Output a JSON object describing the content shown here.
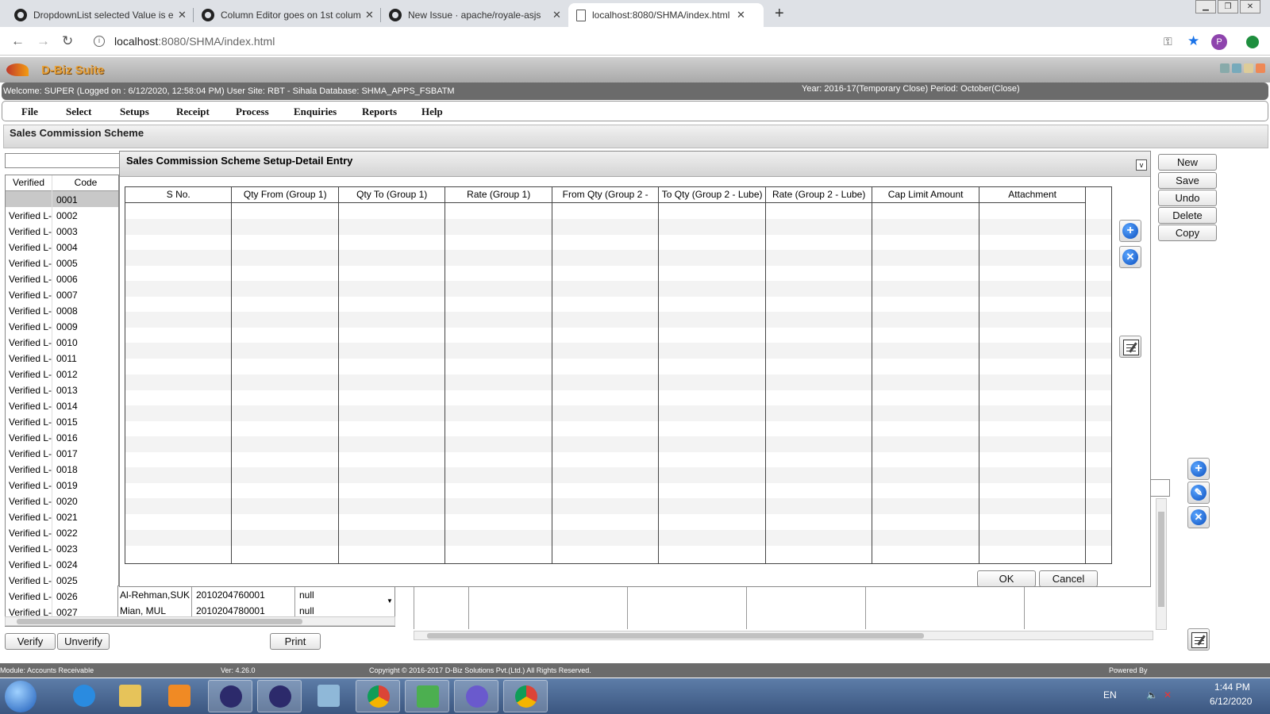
{
  "browser": {
    "tabs": [
      {
        "title": "DropdownList selected Value is e",
        "icon": "github-icon"
      },
      {
        "title": "Column Editor goes on 1st colum",
        "icon": "github-icon"
      },
      {
        "title": "New Issue · apache/royale-asjs",
        "icon": "github-icon"
      },
      {
        "title": "localhost:8080/SHMA/index.html",
        "icon": "page-icon"
      }
    ],
    "url_host": "localhost",
    "url_path": ":8080/SHMA/index.html",
    "new_tab": "+",
    "close_glyph": "✕",
    "profile_initial": "P"
  },
  "app": {
    "title": "D-Biz Suite",
    "welcome": "Welcome: SUPER (Logged on : 6/12/2020, 12:58:04 PM) User Site: RBT - Sihala Database: SHMA_APPS_FSBATM",
    "period": "Year: 2016-17(Temporary Close) Period: October(Close)",
    "menu": [
      "File",
      "Select",
      "Setups",
      "Receipt",
      "Process",
      "Enquiries",
      "Reports",
      "Help"
    ],
    "page_title": "Sales Commission Scheme"
  },
  "left_grid": {
    "headers": [
      "Verified",
      "Code"
    ],
    "rows": [
      {
        "verified": "",
        "code": "0001"
      },
      {
        "verified": "Verified L-",
        "code": "0002"
      },
      {
        "verified": "Verified L-",
        "code": "0003"
      },
      {
        "verified": "Verified L-",
        "code": "0004"
      },
      {
        "verified": "Verified L-",
        "code": "0005"
      },
      {
        "verified": "Verified L-",
        "code": "0006"
      },
      {
        "verified": "Verified L-",
        "code": "0007"
      },
      {
        "verified": "Verified L-",
        "code": "0008"
      },
      {
        "verified": "Verified L-",
        "code": "0009"
      },
      {
        "verified": "Verified L-",
        "code": "0010"
      },
      {
        "verified": "Verified L-",
        "code": "0011"
      },
      {
        "verified": "Verified L-",
        "code": "0012"
      },
      {
        "verified": "Verified L-",
        "code": "0013"
      },
      {
        "verified": "Verified L-",
        "code": "0014"
      },
      {
        "verified": "Verified L-",
        "code": "0015"
      },
      {
        "verified": "Verified L-",
        "code": "0016"
      },
      {
        "verified": "Verified L-",
        "code": "0017"
      },
      {
        "verified": "Verified L-",
        "code": "0018"
      },
      {
        "verified": "Verified L-",
        "code": "0019"
      },
      {
        "verified": "Verified L-",
        "code": "0020"
      },
      {
        "verified": "Verified L-",
        "code": "0021"
      },
      {
        "verified": "Verified L-",
        "code": "0022"
      },
      {
        "verified": "Verified L-",
        "code": "0023"
      },
      {
        "verified": "Verified L-",
        "code": "0024"
      },
      {
        "verified": "Verified L-",
        "code": "0025"
      },
      {
        "verified": "Verified L-",
        "code": "0026"
      },
      {
        "verified": "Verified L-",
        "code": "0027"
      }
    ]
  },
  "lower_grid": {
    "rows": [
      {
        "name": "Al-Rehman,SUK",
        "account": "2010204760001",
        "value": "null"
      },
      {
        "name": "Mian, MUL",
        "account": "2010204780001",
        "value": "null"
      }
    ]
  },
  "dialog": {
    "title": "Sales Commission Scheme Setup-Detail Entry",
    "collapse_glyph": "v",
    "columns": [
      "S No.",
      "Qty From (Group 1)",
      "Qty To (Group 1)",
      "Rate (Group 1)",
      "From Qty (Group 2 -",
      "To Qty (Group 2 - Lube)",
      "Rate (Group 2 - Lube)",
      "Cap Limit Amount",
      "Attachment"
    ],
    "ok_label": "OK",
    "cancel_label": "Cancel",
    "add_glyph": "+",
    "remove_glyph": "✕"
  },
  "action_buttons": [
    "New",
    "Save",
    "Undo",
    "Delete",
    "Copy"
  ],
  "bottom_buttons": {
    "verify": "Verify",
    "unverify": "Unverify",
    "print": "Print"
  },
  "side_icons": {
    "add_glyph": "+",
    "edit_glyph": "✎",
    "remove_glyph": "✕"
  },
  "status_bar": {
    "module": "Module: Accounts Receivable",
    "version": "Ver: 4.26.0",
    "copyright": "Copyright © 2016-2017 D-Biz Solutions Pvt.(Ltd.) All Rights Reserved.",
    "powered": "Powered By"
  },
  "taskbar": {
    "lang": "EN",
    "time": "1:44 PM",
    "date": "6/12/2020"
  },
  "colors": {
    "info_bar": "#6b6b6b",
    "app_title": "#e8a23a",
    "taskbar": "#3b5680"
  }
}
